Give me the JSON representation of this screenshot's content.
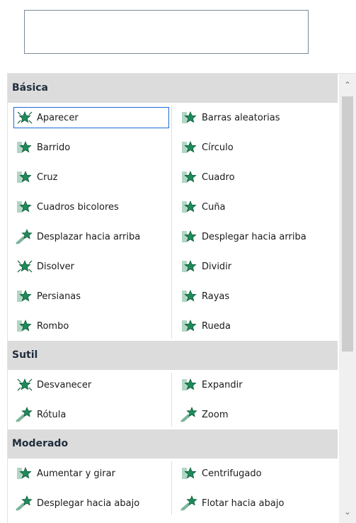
{
  "groups": [
    {
      "title": "Básica",
      "items": [
        {
          "label": "Aparecer",
          "icon": "star-burst-icon",
          "selected": true
        },
        {
          "label": "Barras aleatorias",
          "icon": "star-bars-icon"
        },
        {
          "label": "Barrido",
          "icon": "star-wipe-icon"
        },
        {
          "label": "Círculo",
          "icon": "star-circle-icon"
        },
        {
          "label": "Cruz",
          "icon": "star-cross-icon"
        },
        {
          "label": "Cuadro",
          "icon": "star-box-icon"
        },
        {
          "label": "Cuadros bicolores",
          "icon": "star-checkerboard-icon"
        },
        {
          "label": "Cuña",
          "icon": "star-wedge-icon"
        },
        {
          "label": "Desplazar hacia arriba",
          "icon": "shooting-star-icon"
        },
        {
          "label": "Desplegar hacia arriba",
          "icon": "star-unfold-icon"
        },
        {
          "label": "Disolver",
          "icon": "star-dissolve-icon"
        },
        {
          "label": "Dividir",
          "icon": "star-split-icon"
        },
        {
          "label": "Persianas",
          "icon": "star-blinds-icon"
        },
        {
          "label": "Rayas",
          "icon": "star-stripes-icon"
        },
        {
          "label": "Rombo",
          "icon": "star-diamond-icon"
        },
        {
          "label": "Rueda",
          "icon": "star-wheel-icon"
        }
      ]
    },
    {
      "title": "Sutil",
      "items": [
        {
          "label": "Desvanecer",
          "icon": "star-fade-icon"
        },
        {
          "label": "Expandir",
          "icon": "star-expand-icon"
        },
        {
          "label": "Rótula",
          "icon": "shooting-star-icon"
        },
        {
          "label": "Zoom",
          "icon": "shooting-star-icon"
        }
      ]
    },
    {
      "title": "Moderado",
      "items": [
        {
          "label": "Aumentar y girar",
          "icon": "star-grow-turn-icon"
        },
        {
          "label": "Centrifugado",
          "icon": "star-spin-icon"
        },
        {
          "label": "Desplegar hacia abajo",
          "icon": "shooting-star-icon"
        },
        {
          "label": "Flotar hacia abajo",
          "icon": "shooting-star-icon"
        }
      ]
    }
  ],
  "colors": {
    "star_fill": "#1f8a5a",
    "star_dark": "#0f5a38",
    "accent_selected": "#1e6bd6",
    "group_header_bg": "#dcdcdc"
  }
}
